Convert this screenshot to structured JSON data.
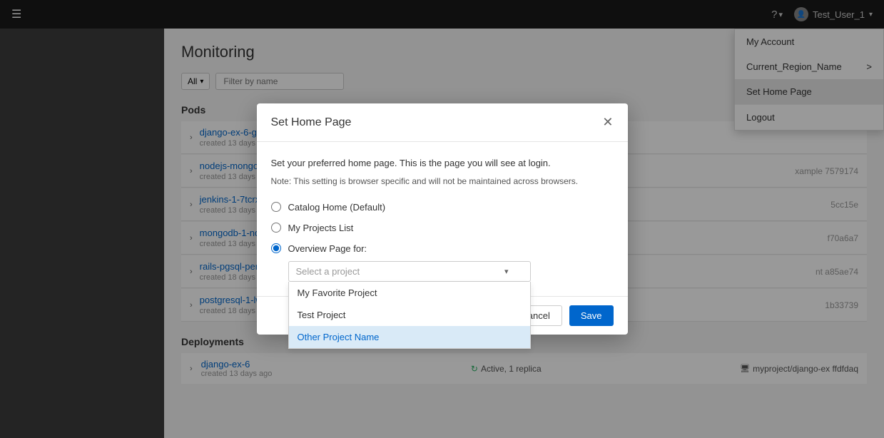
{
  "topNav": {
    "hamburger": "☰",
    "helpLabel": "?",
    "helpDropdownArrow": "▾",
    "userName": "Test_User_1",
    "userDropdownArrow": "▾"
  },
  "userDropdown": {
    "items": [
      {
        "id": "my-account",
        "label": "My Account",
        "active": false,
        "arrow": ""
      },
      {
        "id": "current-region",
        "label": "Current_Region_Name",
        "active": false,
        "arrow": ">"
      },
      {
        "id": "set-home-page",
        "label": "Set Home Page",
        "active": true,
        "arrow": ""
      },
      {
        "id": "logout",
        "label": "Logout",
        "active": false,
        "arrow": ""
      }
    ]
  },
  "main": {
    "pageTitle": "Monitoring",
    "filterAll": "All",
    "filterPlaceholder": "Filter by name",
    "podsSection": "Pods",
    "pods": [
      {
        "name": "django-ex-6-grp15",
        "meta": "created 13 days ago",
        "right": ""
      },
      {
        "name": "nodejs-mongodb-example-3-b",
        "meta": "created 13 days ago",
        "right": "xample 7579174"
      },
      {
        "name": "jenkins-1-7tcrx",
        "meta": "created 13 days ago",
        "right": "5cc15e"
      },
      {
        "name": "mongodb-1-nd6kh",
        "meta": "created 13 days ago",
        "right": "f70a6a7"
      },
      {
        "name": "rails-pgsql-persistent-1-mwcc",
        "meta": "created 18 days ago",
        "right": "nt a85ae74"
      },
      {
        "name": "postgresql-1-lwf8t",
        "meta": "created 18 days ago",
        "right": "1b33739"
      }
    ],
    "deploymentsSection": "Deployments",
    "deployments": [
      {
        "name": "django-ex-6",
        "meta": "created 13 days ago",
        "status": "Active, 1 replica",
        "path": "myproject/django-ex ffdfdaq"
      }
    ]
  },
  "modal": {
    "title": "Set Home Page",
    "description": "Set your preferred home page.  This is the page you will see at login.",
    "note": "Note: This setting is browser specific and will not be maintained across browsers.",
    "options": [
      {
        "id": "catalog-home",
        "label": "Catalog Home (Default)",
        "checked": false
      },
      {
        "id": "my-projects",
        "label": "My Projects List",
        "checked": false
      },
      {
        "id": "overview-page",
        "label": "Overview Page for:",
        "checked": true
      }
    ],
    "selectPlaceholder": "Select a project",
    "projects": [
      {
        "id": "my-favorite",
        "label": "My Favorite Project",
        "highlighted": false
      },
      {
        "id": "test-project",
        "label": "Test Project",
        "highlighted": false
      },
      {
        "id": "other-project",
        "label": "Other Project Name",
        "highlighted": true
      }
    ],
    "cancelLabel": "Cancel",
    "saveLabel": "Save"
  }
}
